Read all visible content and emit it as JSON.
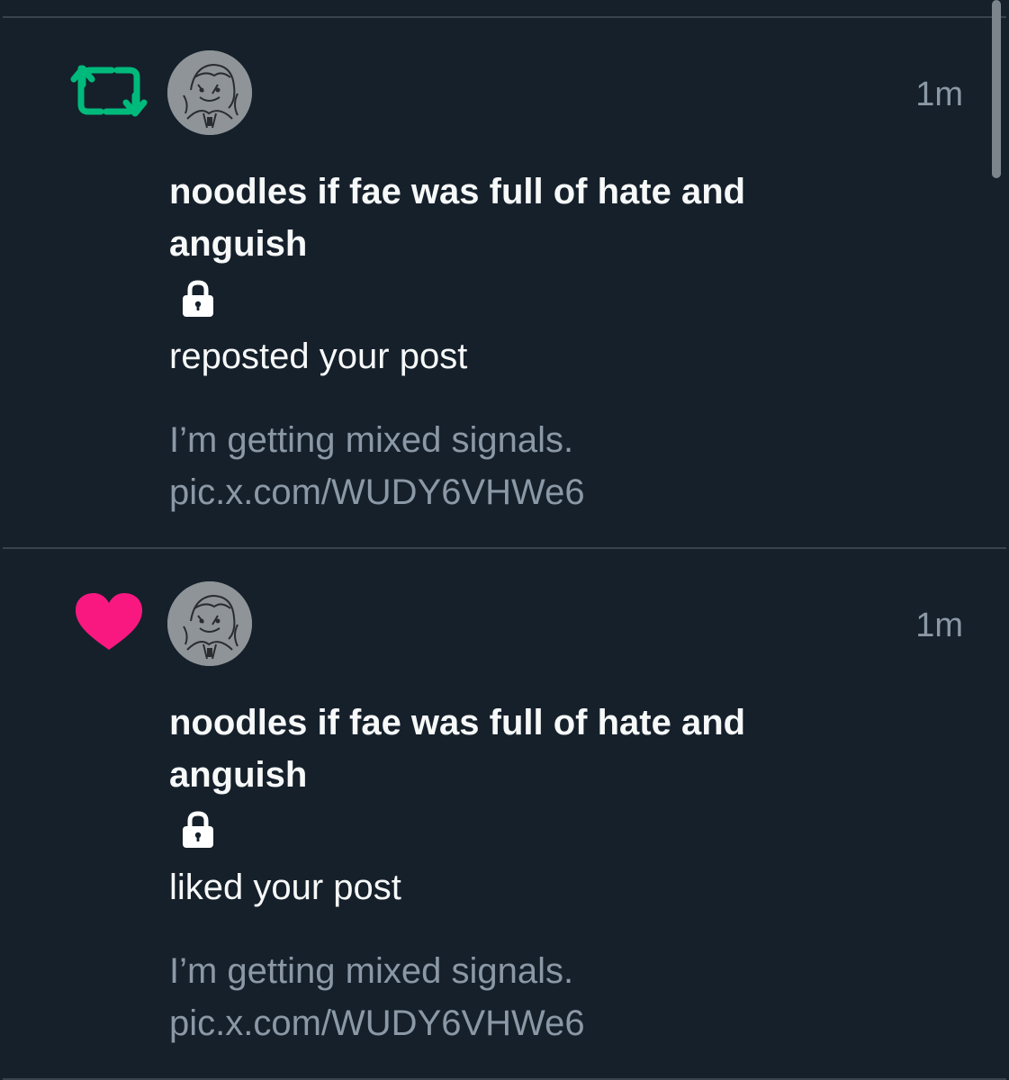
{
  "colors": {
    "background": "#15202b",
    "divider": "#38444d",
    "repost_icon": "#00ba7c",
    "like_icon": "#f91880",
    "secondary_text": "#8b98a5",
    "primary_text": "#f7f9f9"
  },
  "notifications": [
    {
      "type": "repost",
      "icon": "repost-icon",
      "timestamp": "1m",
      "username": "noodles if fae was full of hate and anguish",
      "protected_icon": "lock-icon",
      "action": "reposted your post",
      "post_text": "I’m getting mixed signals.",
      "post_link": "pic.x.com/WUDY6VHWe6"
    },
    {
      "type": "like",
      "icon": "heart-icon",
      "timestamp": "1m",
      "username": "noodles if fae was full of hate and anguish",
      "protected_icon": "lock-icon",
      "action": "liked your post",
      "post_text": "I’m getting mixed signals.",
      "post_link": "pic.x.com/WUDY6VHWe6"
    }
  ]
}
